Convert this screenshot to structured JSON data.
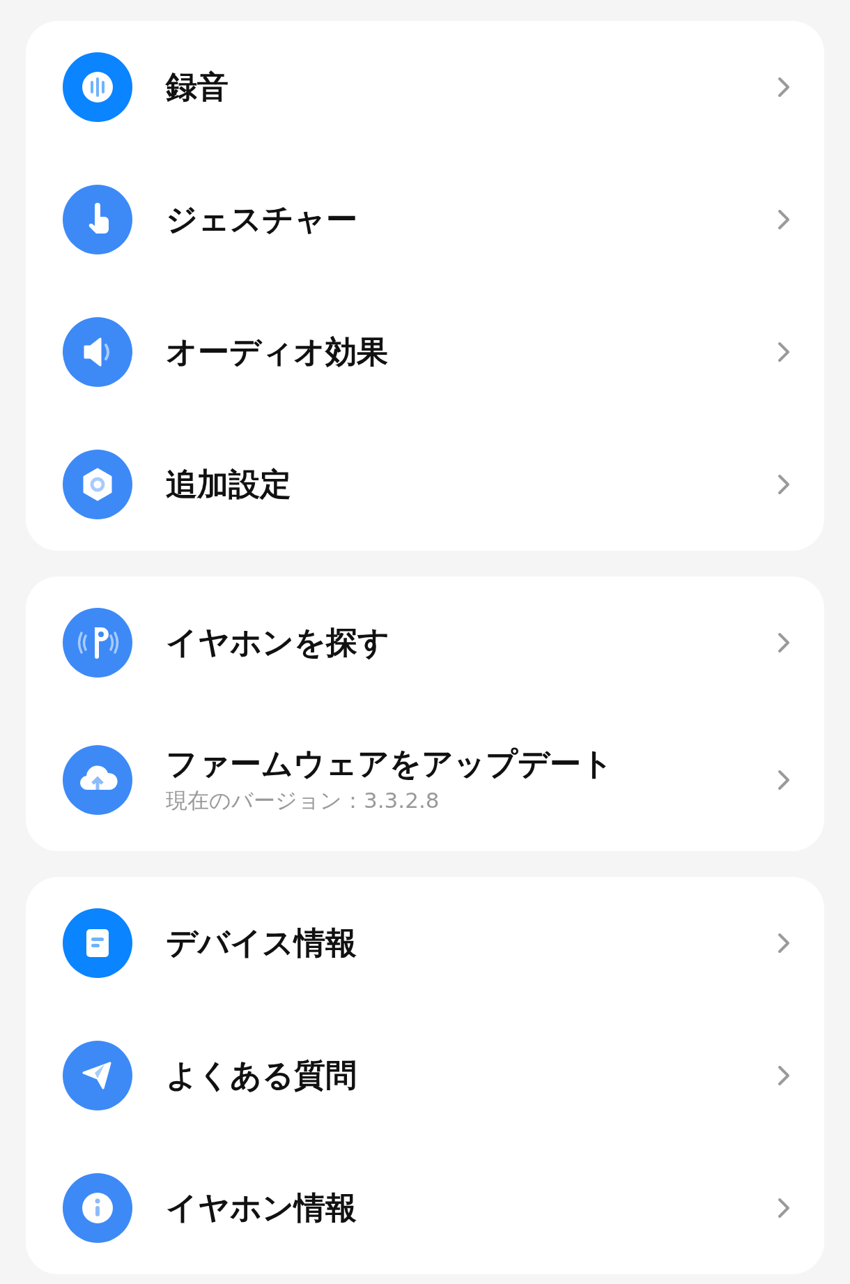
{
  "sections": [
    {
      "items": [
        {
          "label": "録音"
        },
        {
          "label": "ジェスチャー"
        },
        {
          "label": "オーディオ効果"
        },
        {
          "label": "追加設定"
        }
      ]
    },
    {
      "items": [
        {
          "label": "イヤホンを探す"
        },
        {
          "label": "ファームウェアをアップデート",
          "subtitle": "現在のバージョン：3.3.2.8"
        }
      ]
    },
    {
      "items": [
        {
          "label": "デバイス情報"
        },
        {
          "label": "よくある質問"
        },
        {
          "label": "イヤホン情報"
        }
      ]
    }
  ]
}
